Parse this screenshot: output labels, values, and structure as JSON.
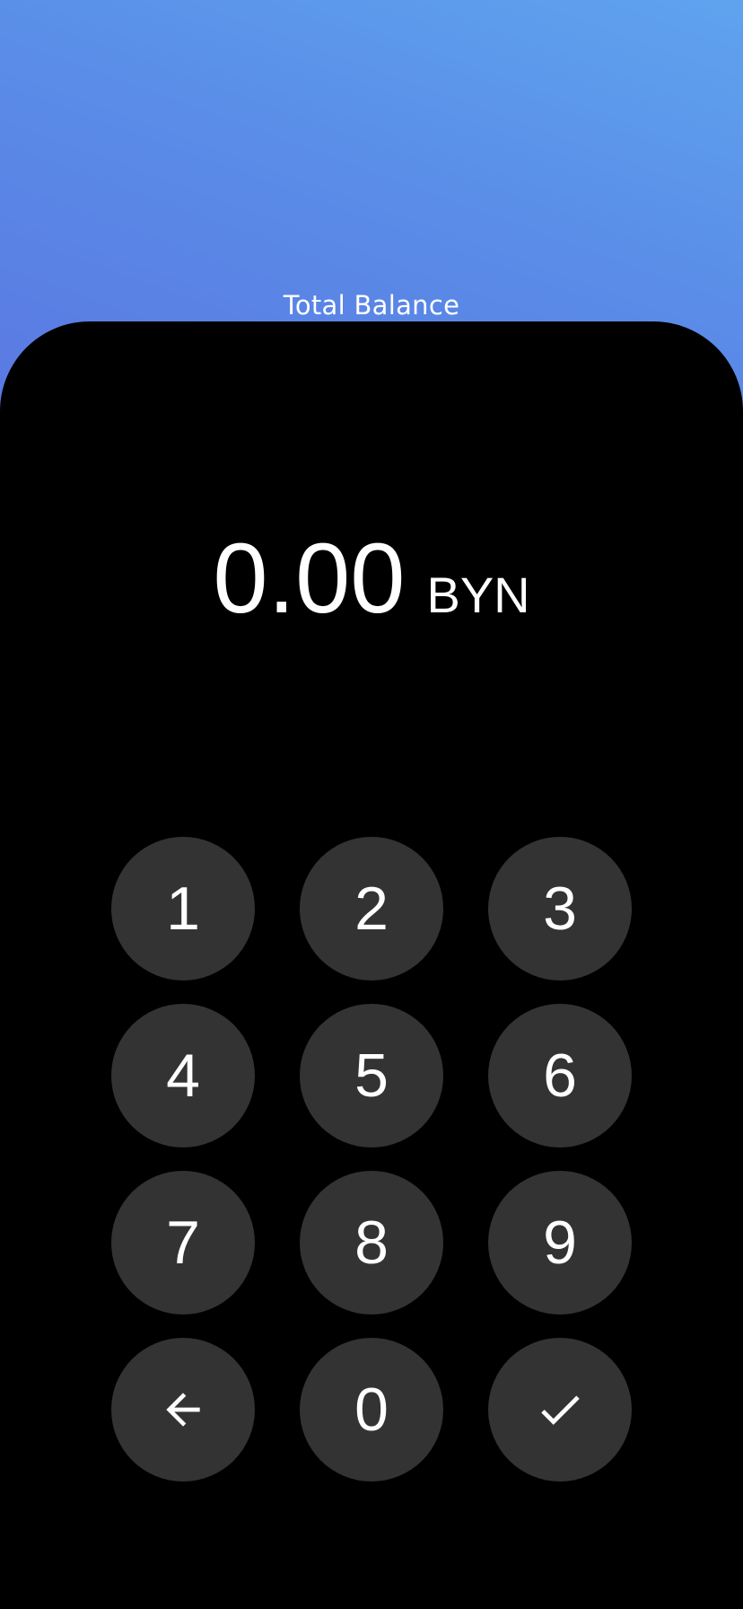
{
  "header": {
    "title": "Total Balance",
    "gradient_colors": [
      "#5fa3ee",
      "#5a78e2"
    ]
  },
  "amount": {
    "value": "0.00",
    "currency": "BYN"
  },
  "keypad": {
    "keys": [
      "1",
      "2",
      "3",
      "4",
      "5",
      "6",
      "7",
      "8",
      "9"
    ],
    "backspace_icon": "arrow-left-icon",
    "zero": "0",
    "confirm_icon": "check-icon",
    "key_color": "#333333",
    "text_color": "#ffffff"
  }
}
